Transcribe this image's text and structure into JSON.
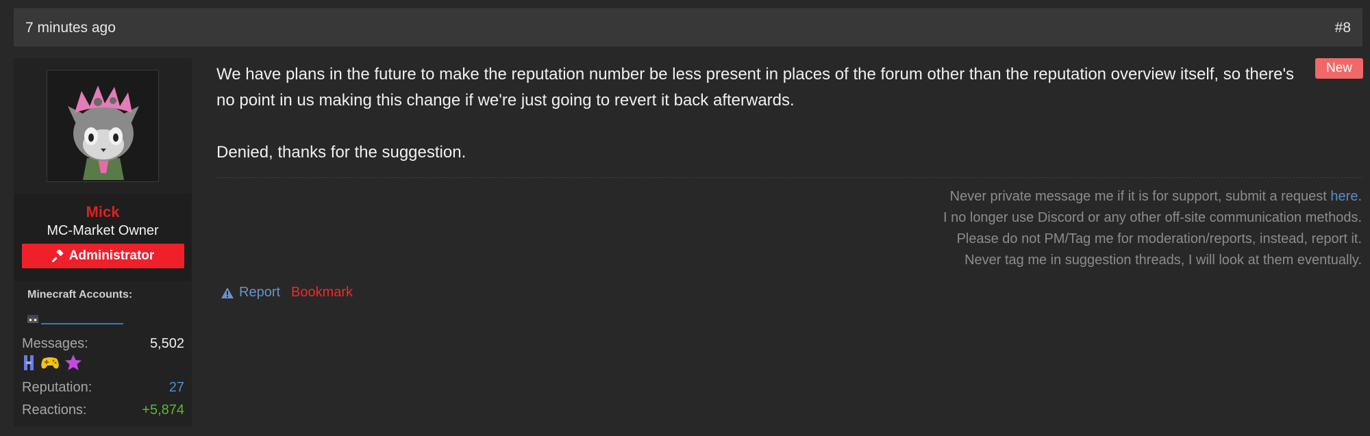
{
  "post": {
    "time": "7 minutes ago",
    "number": "#8",
    "badge": "New",
    "paragraphs": [
      "We have plans in the future to make the reputation number be less present in places of the forum other than the reputation overview itself, so there's no point in us making this change if we're just going to revert it back afterwards.",
      "Denied, thanks for the suggestion."
    ]
  },
  "user": {
    "name": "Mick",
    "title": "MC-Market Owner",
    "role": "Administrator",
    "role_icon": "gavel-icon",
    "minecraft_label": "Minecraft Accounts:",
    "stats": [
      {
        "label": "Messages:",
        "value": "5,502"
      },
      {
        "label": "Reputation:",
        "value": "27"
      },
      {
        "label": "Reactions:",
        "value": "+5,874"
      }
    ],
    "trophies": [
      "pillar-icon",
      "gamepad-icon",
      "star-icon"
    ]
  },
  "signature": {
    "line1_text": "Never private message me if it is for support, submit a request ",
    "line1_link": "here",
    "line1_end": ".",
    "line2": "I no longer use Discord or any other off-site communication methods.",
    "line3": "Please do not PM/Tag me for moderation/reports, instead, report it.",
    "line4": "Never tag me in suggestion threads, I will look at them eventually."
  },
  "actions": {
    "report": "Report",
    "report_icon": "warning-icon",
    "bookmark": "Bookmark"
  },
  "colors": {
    "username": "#e02020",
    "role_banner": "#f0202a",
    "link": "#5c8bc4",
    "badge_new": "#f06868",
    "reputation": "#4f8fd0",
    "reactions": "#5fb832"
  }
}
